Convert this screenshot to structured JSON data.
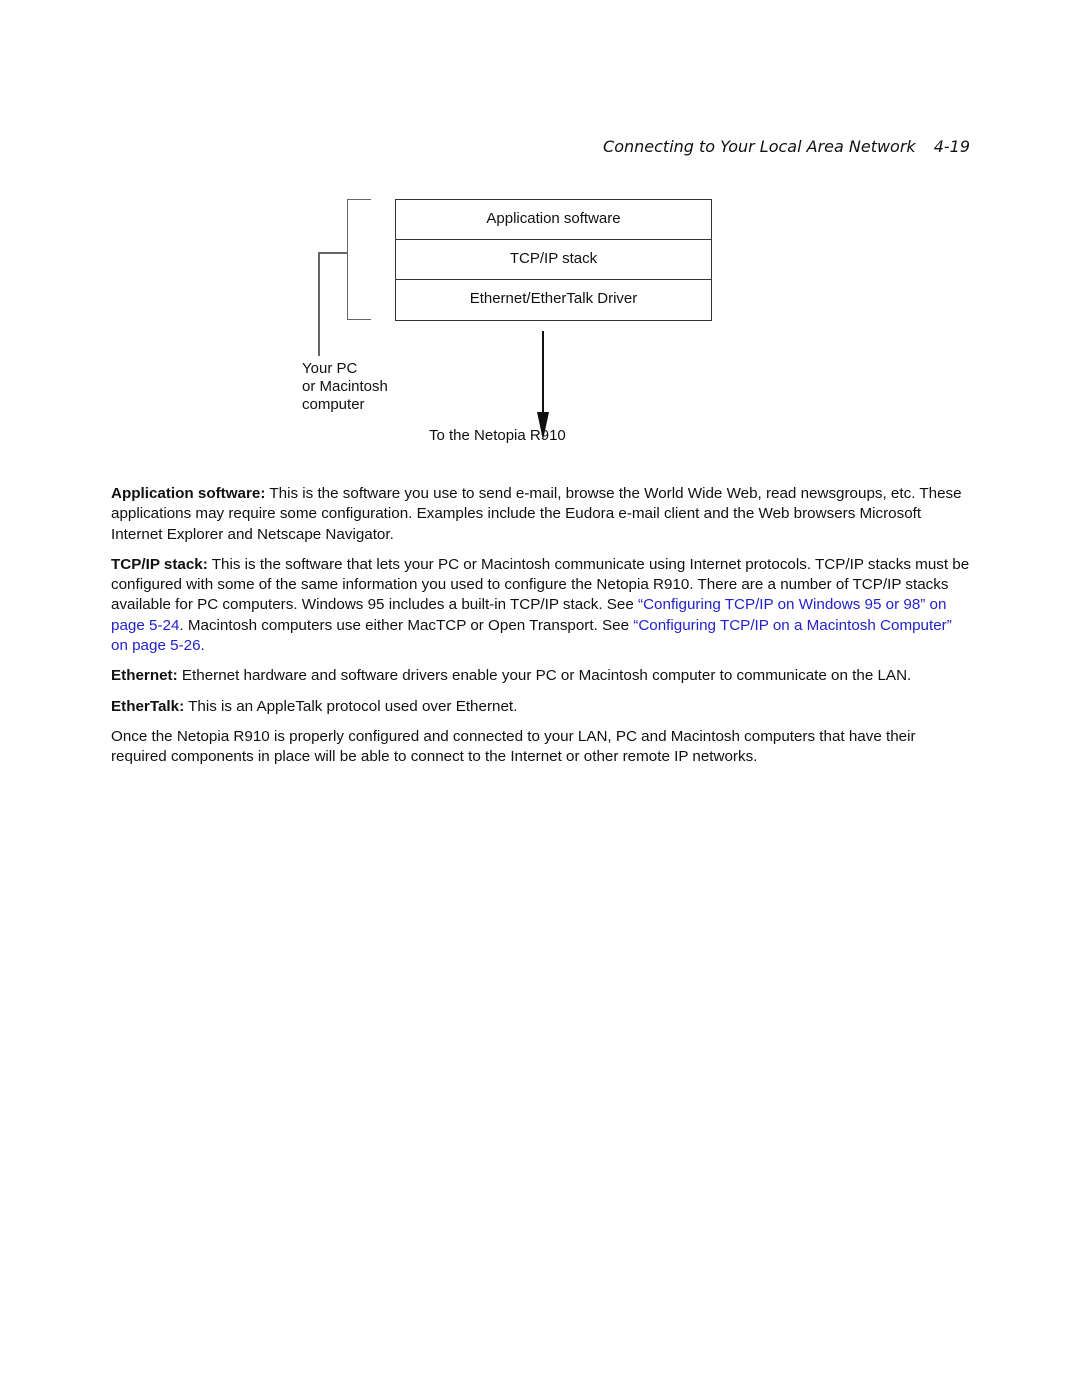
{
  "header": {
    "title": "Connecting to Your Local Area Network",
    "page": "4-19"
  },
  "diagram": {
    "layers": [
      "Application software",
      "TCP/IP stack",
      "Ethernet/EtherTalk Driver"
    ],
    "computer_label": [
      "Your PC",
      "or Macintosh",
      "computer"
    ],
    "arrow_label": "To the Netopia R910"
  },
  "paragraphs": {
    "app": {
      "term": "Application software:",
      "text": " This is the software you use to send e-mail, browse the World Wide Web, read newsgroups, etc. These applications may require some configuration. Examples include the Eudora e-mail client and the Web browsers Microsoft Internet Explorer and Netscape Navigator."
    },
    "tcp": {
      "term": "TCP/IP stack:",
      "text1": "  This is the software that lets your PC or Macintosh communicate using Internet protocols. TCP/IP stacks must be configured with some of the same information you used to configure the Netopia R910. There are a number of TCP/IP stacks available for PC computers. Windows 95 includes a built-in TCP/IP stack. See ",
      "link1": "“Configuring TCP/IP on Windows 95 or 98” on page 5-24",
      "text2": ". Macintosh computers use either MacTCP or Open Transport. See ",
      "link2": "“Configuring TCP/IP on a Macintosh Computer” on page 5-26",
      "text3": "."
    },
    "ethernet": {
      "term": "Ethernet:",
      "text": " Ethernet hardware and software drivers enable your PC or Macintosh computer to communicate on the LAN."
    },
    "ethertalk": {
      "term": "EtherTalk:",
      "text": " This is an AppleTalk protocol used over Ethernet."
    },
    "closing": {
      "text": "Once the Netopia R910 is properly configured and connected to your LAN, PC and Macintosh computers that have their required components in place will be able to connect to the Internet or other remote IP networks."
    }
  }
}
